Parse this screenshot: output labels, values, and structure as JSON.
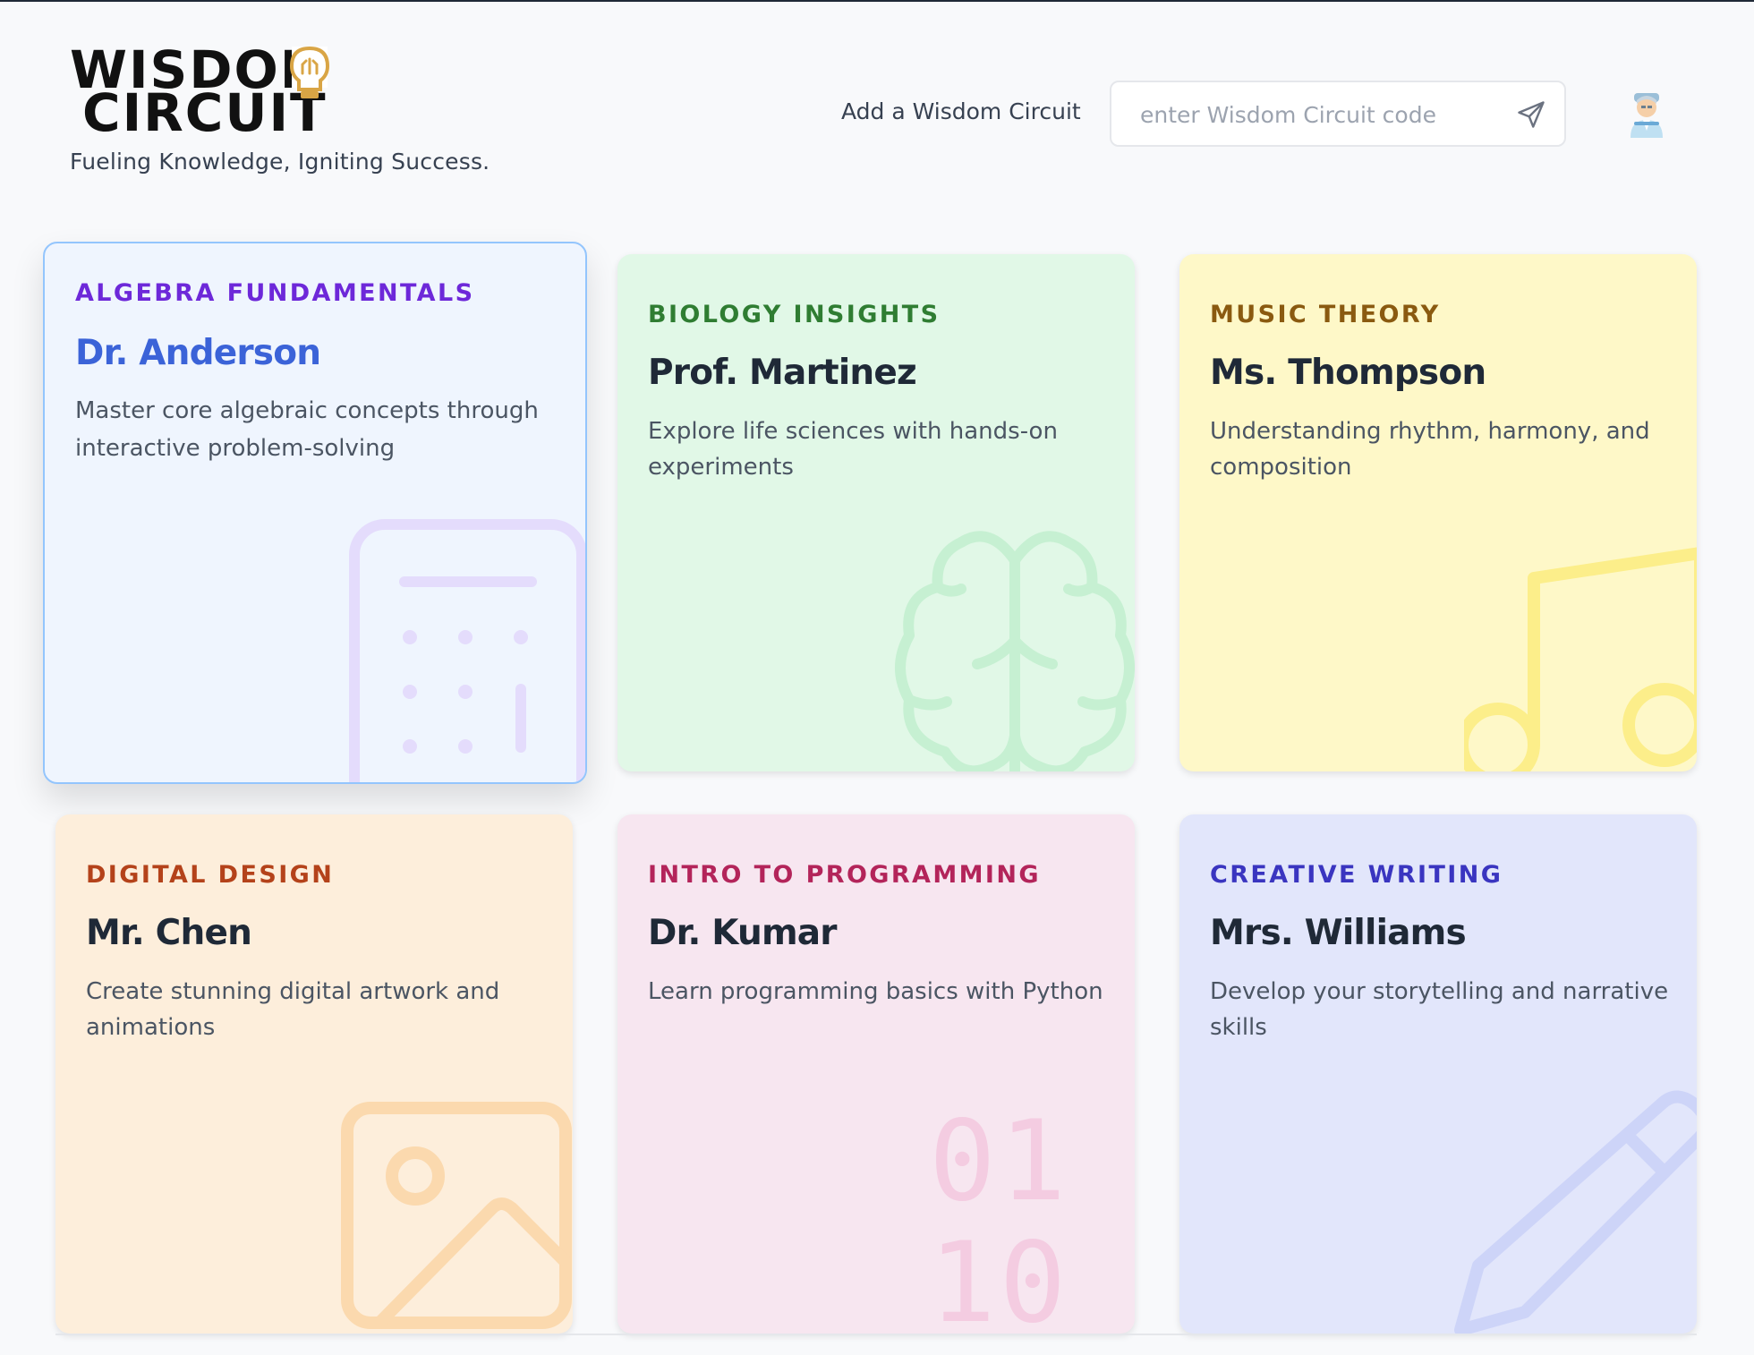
{
  "header": {
    "logo_line1": "WISDOM",
    "logo_line2": "CIRCUIT",
    "tagline": "Fueling Knowledge, Igniting Success.",
    "add_label": "Add a Wisdom Circuit",
    "code_placeholder": "enter Wisdom Circuit code",
    "code_value": ""
  },
  "colors": {
    "page_bg": "#f8f9fb",
    "logo_accent": "#d9a545"
  },
  "cards": [
    {
      "subject": "ALGEBRA FUNDAMENTALS",
      "teacher": "Dr. Anderson",
      "description": "Master core algebraic concepts through interactive problem-solving",
      "bg": "#eff5fe",
      "accent": "#6d28d9",
      "icon": "calculator-icon",
      "selected": true
    },
    {
      "subject": "BIOLOGY INSIGHTS",
      "teacher": "Prof. Martinez",
      "description": "Explore life sciences with hands-on experiments",
      "bg": "#e1f8e7",
      "accent": "#2f7d32",
      "icon": "brain-icon",
      "selected": false
    },
    {
      "subject": "MUSIC THEORY",
      "teacher": "Ms. Thompson",
      "description": "Understanding rhythm, harmony, and composition",
      "bg": "#fef8c8",
      "accent": "#8a5a10",
      "icon": "music-note-icon",
      "selected": false
    },
    {
      "subject": "DIGITAL DESIGN",
      "teacher": "Mr. Chen",
      "description": "Create stunning digital artwork and animations",
      "bg": "#fdeedb",
      "accent": "#b4421a",
      "icon": "image-icon",
      "selected": false
    },
    {
      "subject": "INTRO TO PROGRAMMING",
      "teacher": "Dr. Kumar",
      "description": "Learn programming basics with Python",
      "bg": "#f7e6f0",
      "accent": "#b3245a",
      "icon": "binary-icon",
      "selected": false
    },
    {
      "subject": "CREATIVE WRITING",
      "teacher": "Mrs. Williams",
      "description": "Develop your storytelling and narrative skills",
      "bg": "#e2e6fb",
      "accent": "#3a35c0",
      "icon": "pencil-icon",
      "selected": false
    }
  ],
  "binary_glyphs": {
    "row1": "01",
    "row2": "10"
  }
}
